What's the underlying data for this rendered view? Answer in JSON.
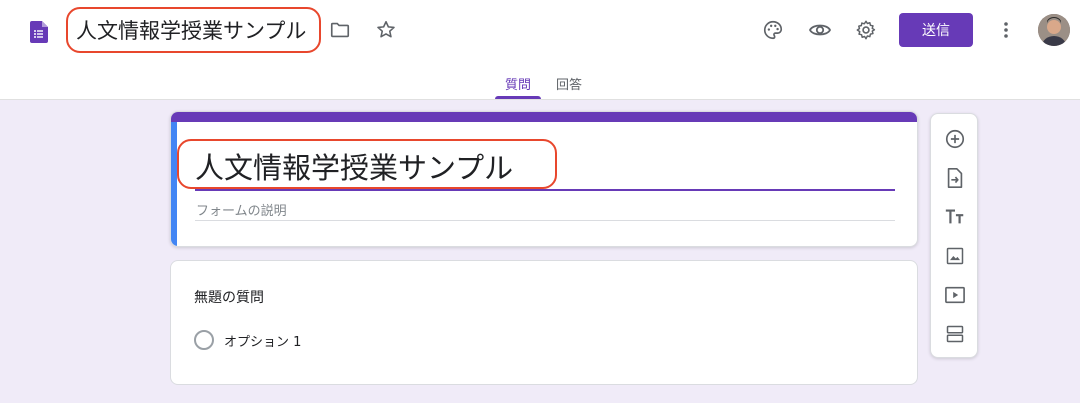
{
  "header": {
    "doc_title": "人文情報学授業サンプル",
    "send_label": "送信",
    "icons": [
      "forms-app-icon",
      "folder-icon",
      "star-icon",
      "palette-icon",
      "eye-icon",
      "gear-icon",
      "more-vert-icon"
    ]
  },
  "tabs": [
    {
      "label": "質問",
      "active": true
    },
    {
      "label": "回答",
      "active": false
    }
  ],
  "form": {
    "title": "人文情報学授業サンプル",
    "description_placeholder": "フォームの説明"
  },
  "question": {
    "title": "無題の質問",
    "options": [
      "オプション 1"
    ]
  },
  "toolbar": {
    "icons": [
      "add-question-icon",
      "import-questions-icon",
      "add-title-icon",
      "add-image-icon",
      "add-video-icon",
      "add-section-icon"
    ]
  },
  "colors": {
    "accent": "#673ab7",
    "highlight": "#e8472d",
    "background": "#f0ebf8",
    "left_bar": "#4285f4"
  }
}
